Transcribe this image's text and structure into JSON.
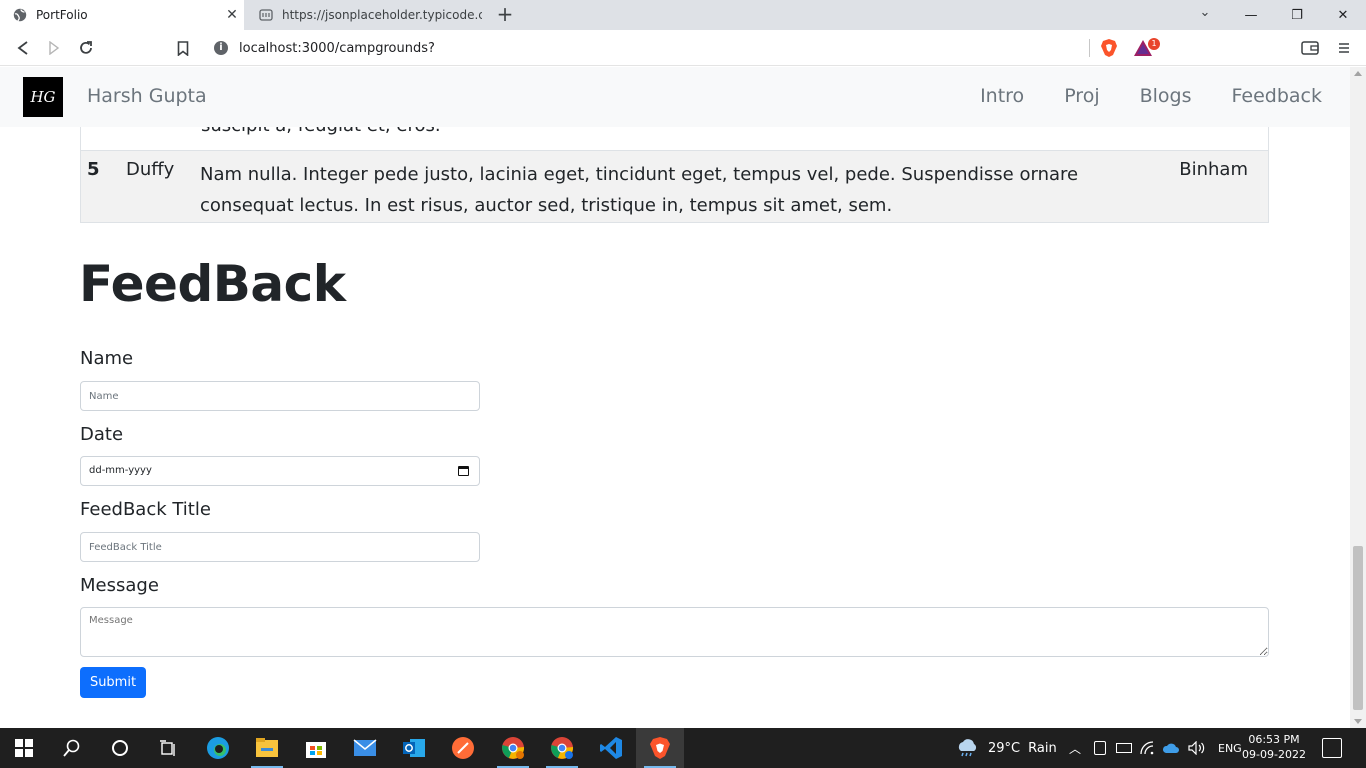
{
  "browser": {
    "tabs": [
      {
        "title": "PortFolio",
        "icon": "globe-icon",
        "active": true
      },
      {
        "title": "https://jsonplaceholder.typicode.com/",
        "icon": "page-icon",
        "active": false
      }
    ],
    "url": "localhost:3000/campgrounds?",
    "rewards_badge": "1"
  },
  "navbar": {
    "logo_text": "HG",
    "brand": "Harsh Gupta",
    "links": [
      "Intro",
      "Proj",
      "Blogs",
      "Feedback"
    ]
  },
  "table": {
    "partial_row_text": "suscipit a, feugiat et, eros.",
    "row": {
      "id": "5",
      "name": "Duffy",
      "body": "Nam nulla. Integer pede justo, lacinia eget, tincidunt eget, tempus vel, pede. Suspendisse ornare consequat lectus. In est risus, auctor sed, tristique in, tempus sit amet, sem.",
      "city": "Binham"
    }
  },
  "feedback": {
    "heading": "FeedBack",
    "name_label": "Name",
    "name_placeholder": "Name",
    "date_label": "Date",
    "date_value": "dd-mm-yyyy",
    "title_label": "FeedBack Title",
    "title_placeholder": "FeedBack Title",
    "message_label": "Message",
    "message_placeholder": "Message",
    "submit_label": "Submit",
    "submit_color": "#0d6efd"
  },
  "taskbar": {
    "weather_temp": "29°C",
    "weather_text": "Rain",
    "language": "ENG",
    "time": "06:53 PM",
    "date": "09-09-2022"
  }
}
